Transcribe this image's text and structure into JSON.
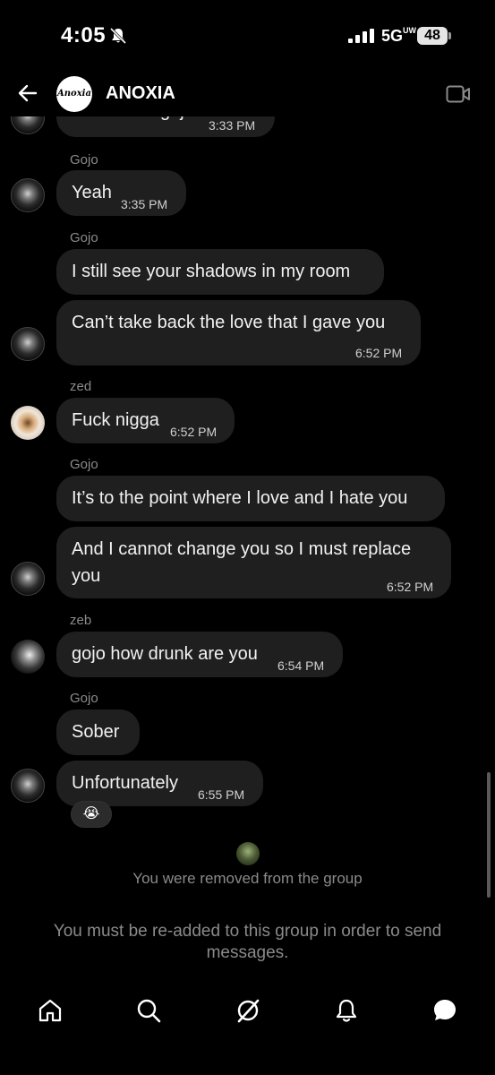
{
  "status_bar": {
    "time": "4:05",
    "network": "5G",
    "network_sup": "UW",
    "battery": "48"
  },
  "header": {
    "group_avatar_text": "Anoxia",
    "group_name": "ANOXIA"
  },
  "messages": [
    {
      "sender": "",
      "text": "beat u to it gojo",
      "time": "3:33 PM"
    },
    {
      "sender": "Gojo",
      "text": "Yeah",
      "time": "3:35 PM"
    },
    {
      "sender": "Gojo",
      "text": "I still see your shadows in my room",
      "time": ""
    },
    {
      "sender": "",
      "text": "Can’t take back the love that I gave you",
      "time": "6:52 PM"
    },
    {
      "sender": "zed",
      "text": "Fuck nigga",
      "time": "6:52 PM"
    },
    {
      "sender": "Gojo",
      "text": "It’s to the point where I love and I hate you",
      "time": ""
    },
    {
      "sender": "",
      "text_line1": "And I cannot change you so I must replace",
      "text_line2": "you",
      "time": "6:52 PM"
    },
    {
      "sender": "zeb",
      "text": "gojo how drunk are you",
      "time": "6:54 PM"
    },
    {
      "sender": "Gojo",
      "text": "Sober",
      "time": ""
    },
    {
      "sender": "",
      "text": "Unfortunately",
      "time": "6:55 PM",
      "reaction": "😭"
    }
  ],
  "notices": {
    "removed": "You were removed from the group",
    "readd": "You must be re-added to this group in order to send messages."
  },
  "nav": [
    "home-icon",
    "search-icon",
    "grok-icon",
    "notifications-icon",
    "messages-icon"
  ],
  "colors": {
    "background": "#000000",
    "bubble": "#1f1f1f",
    "muted_text": "#8a8a8a"
  }
}
